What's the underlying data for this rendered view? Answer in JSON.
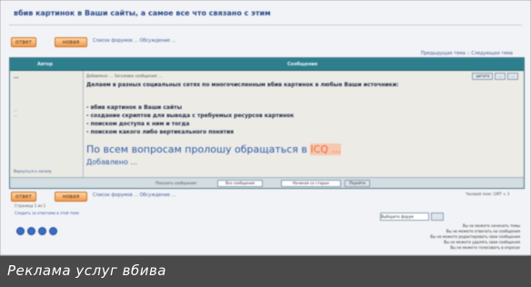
{
  "caption": "Реклама услуг вбива",
  "topic": {
    "title": "вбив картинок в Ваши сайты, а самое все что связано с этим"
  },
  "toolbar_top": {
    "reply_label": "ответ",
    "new_topic_label": "новая",
    "breadcrumb": "Список форумов ...  Обсуждение ...",
    "jump_link": "Предыдущая тема :: Следующая тема"
  },
  "table": {
    "col_author": "Автор",
    "col_message": "Сообщение"
  },
  "post": {
    "author": "...",
    "author_meta": [
      "...",
      "..."
    ],
    "profile_link": "Вернуться к началу",
    "header": "Добавлено: ...   Заголовок сообщения: ...",
    "actions": [
      "цитата",
      "...",
      "..."
    ],
    "lead": "Делаем в разных социальных сетях по многочисленным вбив картинок в любые Ваши источники:",
    "items": [
      "- вбив картинок в Ваши сайты",
      "- создание скриптов для вывода с требуемых ресурсов картинок",
      "- поиском доступа к ним и тогда",
      "- поиском какого либо вертикального понятия"
    ],
    "contact_text": "По всем вопросам пролошу обращаться в",
    "contact_highlight": "ICQ ...",
    "signature": "Добавлено ..."
  },
  "table_footer": {
    "sort_label": "Показать сообщения:",
    "sort_value": "Все сообщения",
    "order_value": "Начиная со старых",
    "go_label": "Перейти"
  },
  "toolbar_bottom": {
    "reply_label": "ответ",
    "new_topic_label": "новая",
    "breadcrumb": "Список форумов ...  Обсуждение ...",
    "timezone": "Часовой пояс: GMT + 3"
  },
  "pagination": "Страница 1 из 1",
  "watch_link": "Следить за ответами в этой теме",
  "jump_select": "Выберите форум",
  "permissions": [
    "Вы не можете начинать темы",
    "Вы не можете отвечать на сообщения",
    "Вы не можете редактировать свои сообщения",
    "Вы не можете удалять свои сообщения",
    "Вы не можете голосовать в опросах"
  ],
  "icons": [
    "...",
    "...",
    "...",
    "..."
  ]
}
